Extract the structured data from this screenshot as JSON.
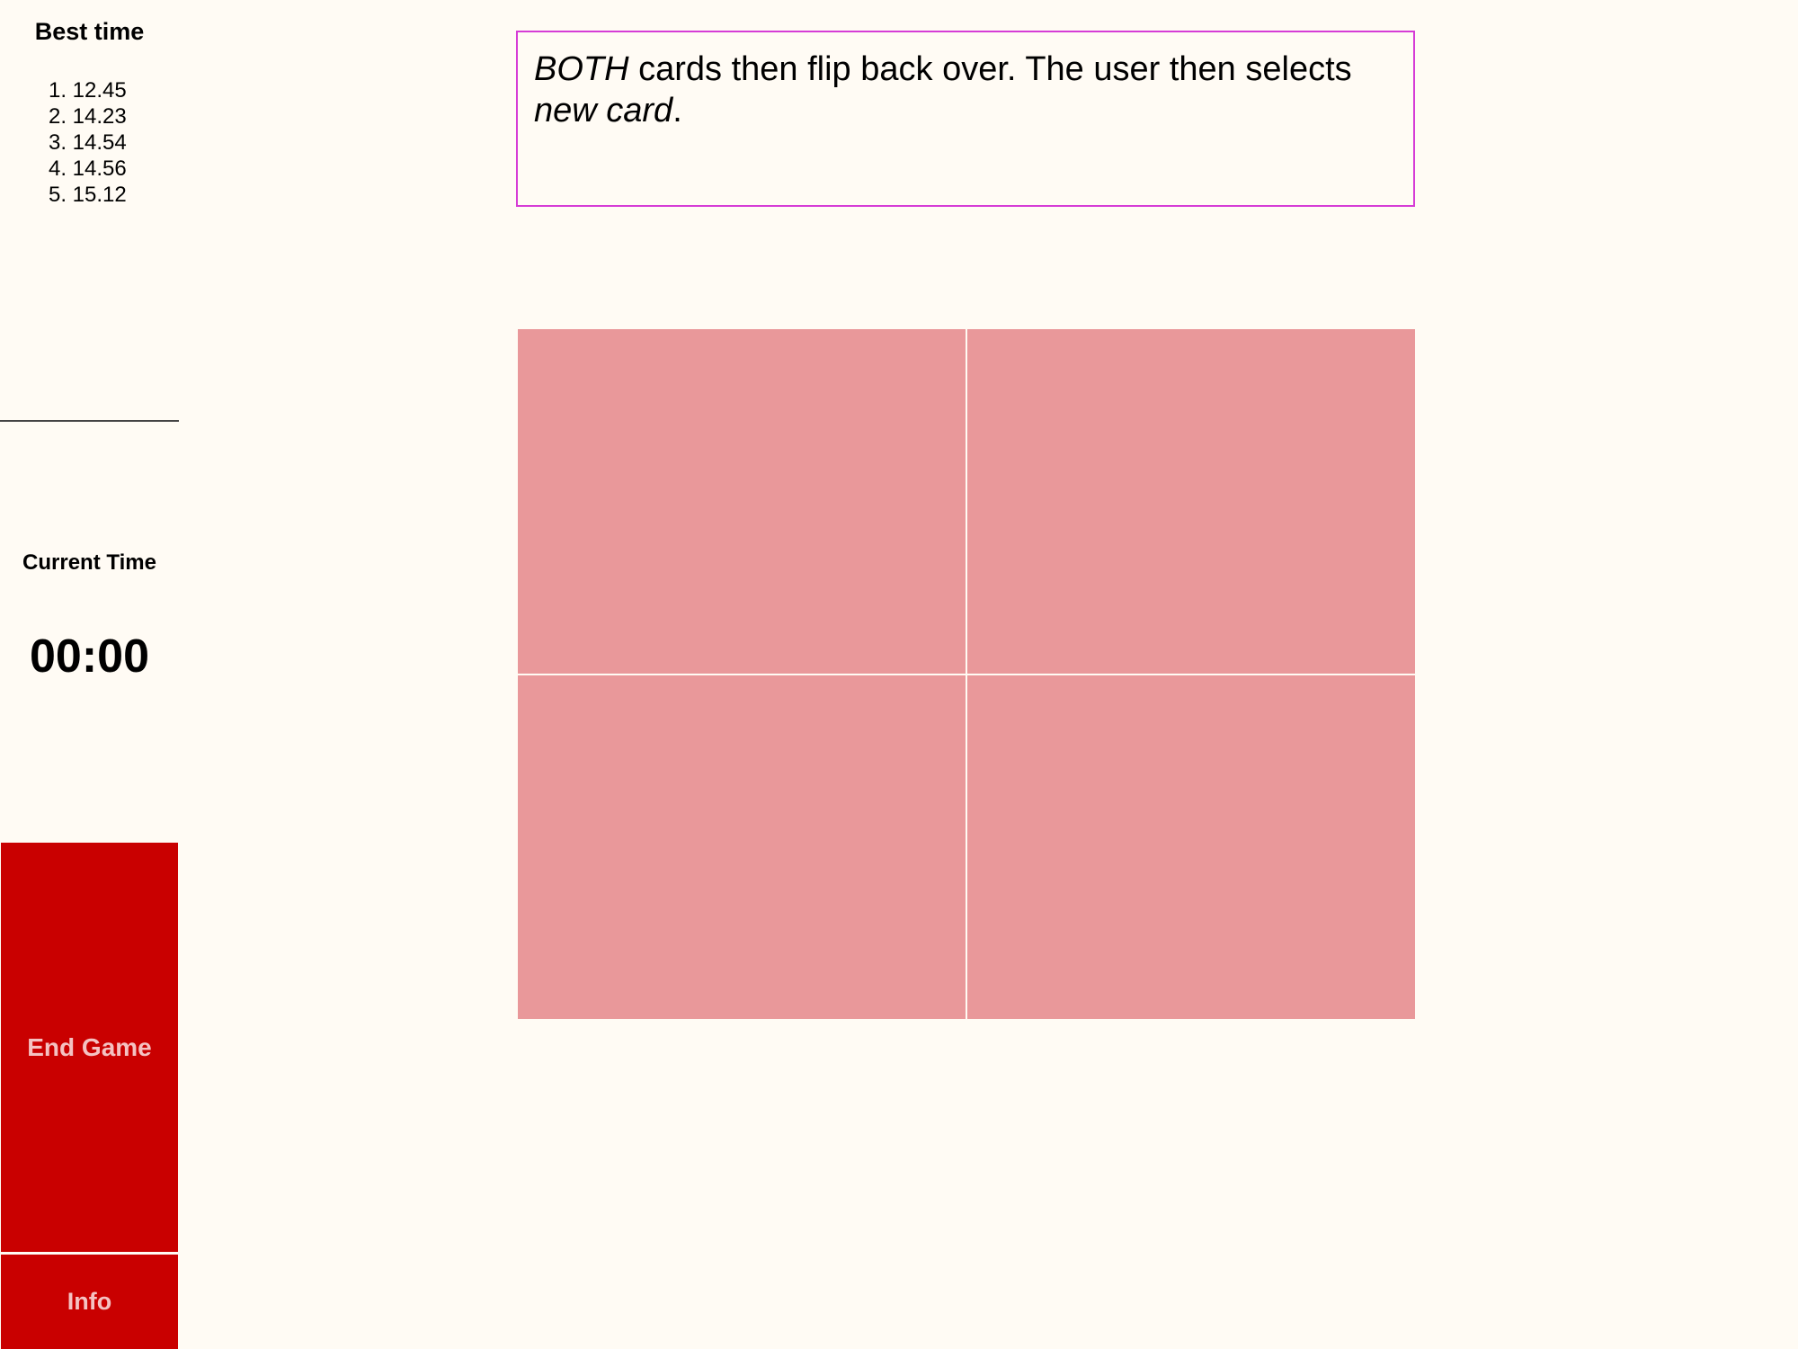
{
  "sidebar": {
    "best_title": "Best time",
    "best_times": [
      "1. 12.45",
      "2. 14.23",
      "3. 14.54",
      "4. 14.56",
      "5. 15.12"
    ],
    "current_title": "Current Time",
    "current_time": "00:00",
    "end_game_label": "End Game",
    "info_label": "Info"
  },
  "instruction": {
    "em1": "BOTH",
    "text1": " cards then flip back over. The user then selects ",
    "em2": "new card",
    "text2": "."
  },
  "cards": [
    {
      "state": "face-down"
    },
    {
      "state": "face-down"
    },
    {
      "state": "face-down"
    },
    {
      "state": "face-down"
    }
  ],
  "colors": {
    "background": "#fffbf4",
    "button": "#c90000",
    "button_text": "#f4c2c2",
    "card": "#e9989a",
    "instruction_border": "#d63cd6"
  }
}
